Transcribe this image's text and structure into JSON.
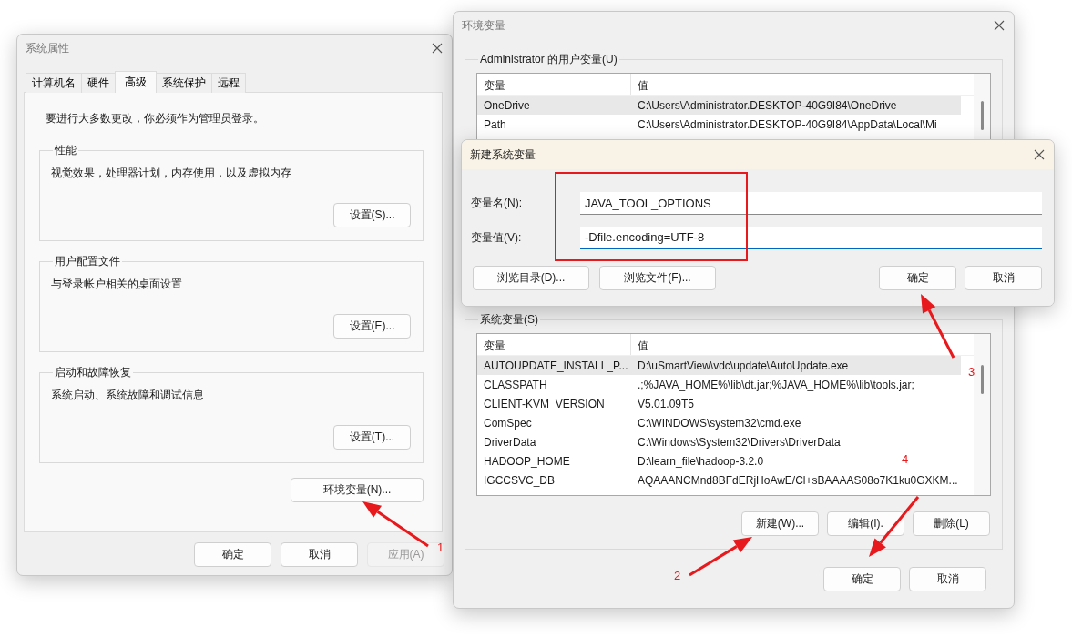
{
  "system_properties": {
    "title": "系统属性",
    "tabs": [
      {
        "label": "计算机名",
        "selected": false
      },
      {
        "label": "硬件",
        "selected": false
      },
      {
        "label": "高级",
        "selected": true
      },
      {
        "label": "系统保护",
        "selected": false
      },
      {
        "label": "远程",
        "selected": false
      }
    ],
    "notice": "要进行大多数更改，你必须作为管理员登录。",
    "groups": [
      {
        "title": "性能",
        "description": "视觉效果，处理器计划，内存使用，以及虚拟内存",
        "button": "设置(S)..."
      },
      {
        "title": "用户配置文件",
        "description": "与登录帐户相关的桌面设置",
        "button": "设置(E)..."
      },
      {
        "title": "启动和故障恢复",
        "description": "系统启动、系统故障和调试信息",
        "button": "设置(T)..."
      }
    ],
    "env_button": "环境变量(N)...",
    "buttons": [
      {
        "label": "确定",
        "disabled": false
      },
      {
        "label": "取消",
        "disabled": false
      },
      {
        "label": "应用(A)",
        "disabled": true
      }
    ]
  },
  "environment_variables": {
    "title": "环境变量",
    "user_group": {
      "title": "Administrator 的用户变量(U)",
      "columns": [
        "变量",
        "值"
      ],
      "rows": [
        {
          "name": "OneDrive",
          "value": "C:\\Users\\Administrator.DESKTOP-40G9I84\\OneDrive",
          "selected": true
        },
        {
          "name": "Path",
          "value": "C:\\Users\\Administrator.DESKTOP-40G9I84\\AppData\\Local\\Mi",
          "selected": false
        }
      ]
    },
    "system_group": {
      "title": "系统变量(S)",
      "columns": [
        "变量",
        "值"
      ],
      "rows": [
        {
          "name": "AUTOUPDATE_INSTALL_P...",
          "value": "D:\\uSmartView\\vdc\\update\\AutoUpdate.exe",
          "selected": true
        },
        {
          "name": "CLASSPATH",
          "value": ".;%JAVA_HOME%\\lib\\dt.jar;%JAVA_HOME%\\lib\\tools.jar;",
          "selected": false
        },
        {
          "name": "CLIENT-KVM_VERSION",
          "value": "V5.01.09T5",
          "selected": false
        },
        {
          "name": "ComSpec",
          "value": "C:\\WINDOWS\\system32\\cmd.exe",
          "selected": false
        },
        {
          "name": "DriverData",
          "value": "C:\\Windows\\System32\\Drivers\\DriverData",
          "selected": false
        },
        {
          "name": "HADOOP_HOME",
          "value": "D:\\learn_file\\hadoop-3.2.0",
          "selected": false
        },
        {
          "name": "IGCCSVC_DB",
          "value": "AQAAANCMnd8BFdERjHoAwE/Cl+sBAAAAS08o7K1ku0GXKM...",
          "selected": false
        }
      ],
      "buttons": [
        "新建(W)...",
        "编辑(I).",
        "删除(L)"
      ]
    },
    "buttons": [
      "确定",
      "取消"
    ]
  },
  "new_variable_dialog": {
    "title": "新建系统变量",
    "fields": [
      {
        "label": "变量名(N):",
        "value": "JAVA_TOOL_OPTIONS",
        "focused": false
      },
      {
        "label": "变量值(V):",
        "value": "-Dfile.encoding=UTF-8",
        "focused": true
      }
    ],
    "left_buttons": [
      "浏览目录(D)...",
      "浏览文件(F)..."
    ],
    "right_buttons": [
      "确定",
      "取消"
    ]
  },
  "annotations": [
    {
      "label": "1"
    },
    {
      "label": "2"
    },
    {
      "label": "3"
    },
    {
      "label": "4"
    }
  ]
}
